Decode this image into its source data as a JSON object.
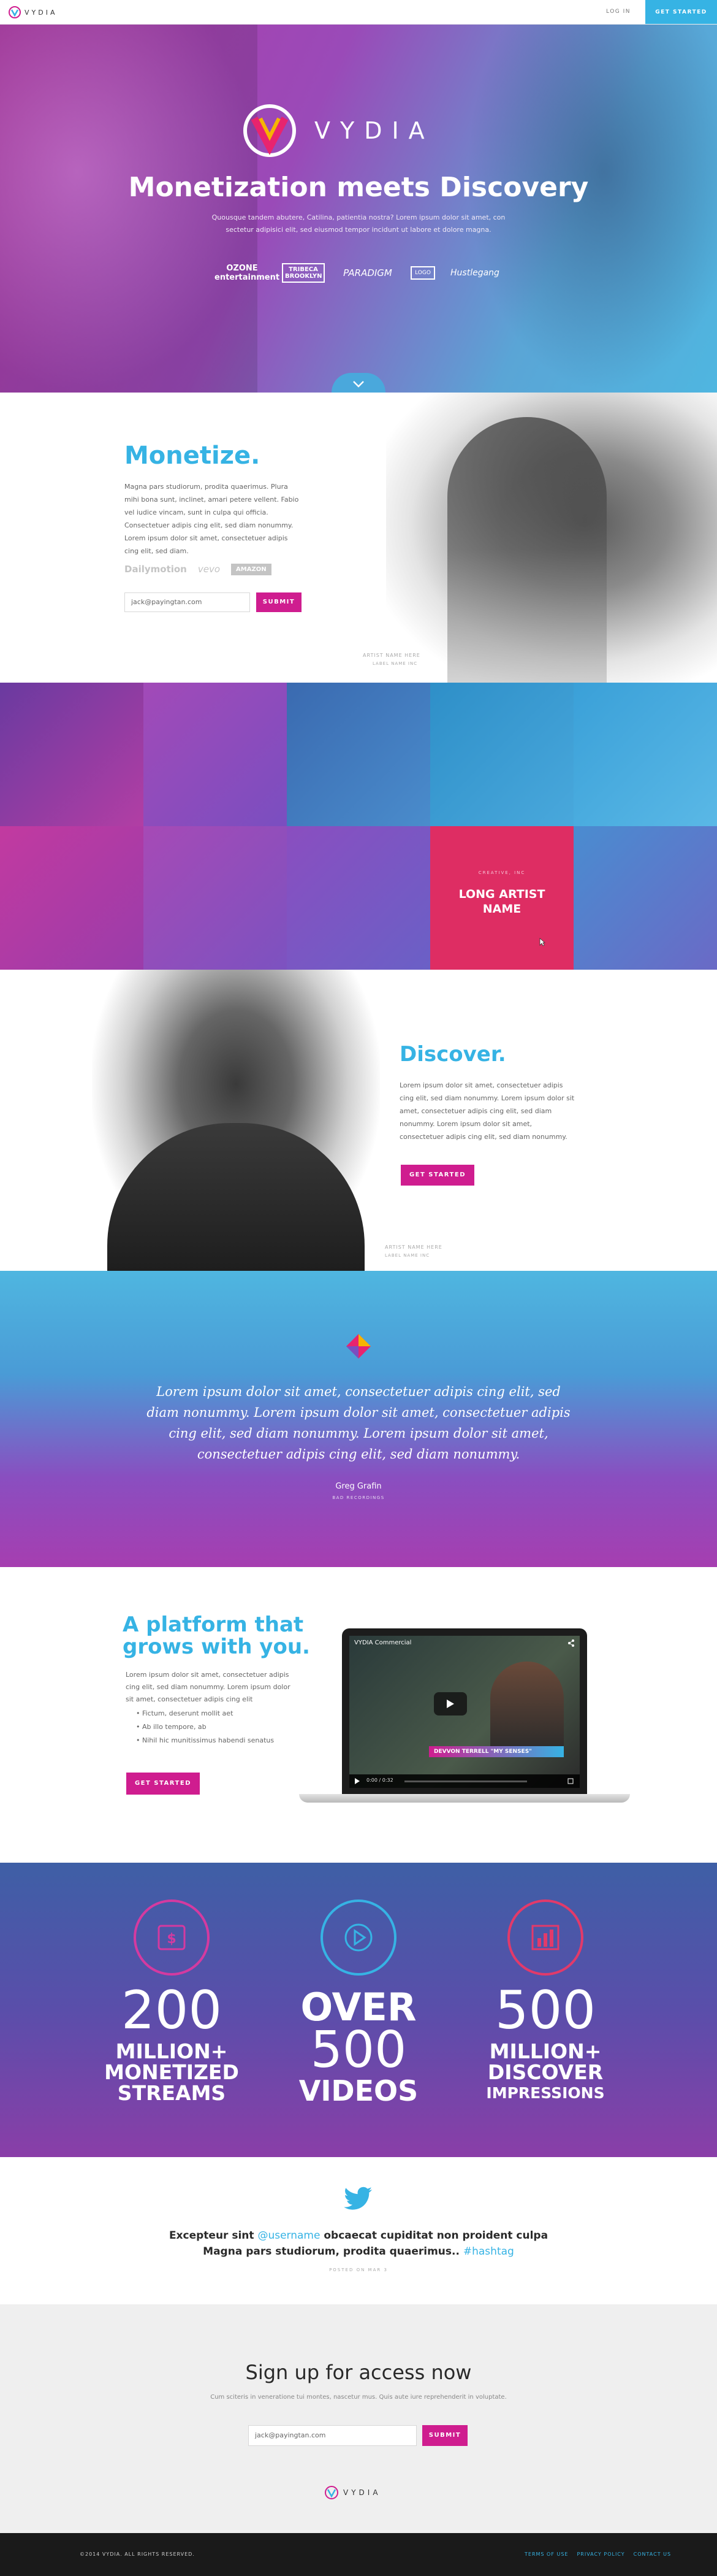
{
  "nav": {
    "brand": "VYDIA",
    "login": "LOG IN",
    "cta": "GET STARTED"
  },
  "hero": {
    "brand": "VYDIA",
    "title": "Monetization meets Discovery",
    "subtitle_line1": "Quousque tandem abutere, Catilina, patientia nostra? Lorem ipsum dolor sit amet, con",
    "subtitle_line2": "sectetur adipisici elit, sed eiusmod tempor incidunt ut labore et dolore magna.",
    "logos": [
      "OZONE entertainment",
      "TRIBECA BROOKLYN",
      "PARADIGM",
      "LOGO",
      "Hustlegang"
    ],
    "scroll_icon": "chevron-down-icon"
  },
  "monetize": {
    "title": "Monetize.",
    "body": "Magna pars studiorum, prodita quaerimus. Plura mihi bona sunt, inclinet, amari petere vellent. Fabio vel iudice vincam, sunt in culpa qui officia. Consectetuer adipis cing elit, sed diam nonummy. Lorem ipsum dolor sit amet, consectetuer adipis cing elit, sed diam.",
    "partners": [
      "Dailymotion",
      "vevo",
      "AMAZON"
    ],
    "email_value": "jack@payingtan.com",
    "submit": "SUBMIT",
    "credit_line1": "ARTIST NAME HERE",
    "credit_line2": "LABEL NAME INC"
  },
  "featured_tile": {
    "kicker": "CREATIVE, INC",
    "name_line1": "LONG ARTIST",
    "name_line2": "NAME"
  },
  "discover": {
    "title": "Discover.",
    "body": "Lorem ipsum dolor sit amet, consectetuer adipis cing elit, sed diam nonummy. Lorem ipsum dolor sit amet, consectetuer adipis cing elit, sed diam nonummy. Lorem ipsum dolor sit amet, consectetuer adipis cing elit, sed diam nonummy.",
    "cta": "GET STARTED",
    "credit_line1": "ARTIST NAME HERE",
    "credit_line2": "LABEL NAME INC"
  },
  "quote": {
    "text": "Lorem ipsum dolor sit amet, consectetuer adipis cing elit, sed diam nonummy. Lorem ipsum dolor sit amet, consectetuer adipis cing elit, sed diam nonummy. Lorem ipsum dolor sit amet, consectetuer adipis cing elit, sed diam nonummy.",
    "author": "Greg Grafin",
    "role": "BAD RECORDINGS"
  },
  "platform": {
    "title_line1": "A platform that",
    "title_line2": "grows with you.",
    "body": "Lorem ipsum dolor sit amet, consectetuer adipis cing elit, sed diam nonummy. Lorem ipsum dolor sit amet, consectetuer adipis cing elit",
    "bullets": [
      "Fictum,  deserunt mollit aet",
      "Ab illo tempore, ab",
      "Nihil hic munitissimus habendi senatus"
    ],
    "cta": "GET STARTED",
    "video_title": "VYDIA Commercial",
    "video_caption": "DEVVON TERRELL \"MY SENSES\"",
    "video_time": "0:00 / 0:32"
  },
  "stats": [
    {
      "icon": "dollar-icon",
      "number": "200",
      "line1": "MILLION+",
      "line2": "MONETIZED",
      "line3": "STREAMS"
    },
    {
      "icon": "play-icon",
      "number_top": "OVER",
      "number": "500",
      "line1": "VIDEOS"
    },
    {
      "icon": "chart-icon",
      "number": "500",
      "line1": "MILLION+",
      "line2": "DISCOVER",
      "line3": "IMPRESSIONS"
    }
  ],
  "tweet": {
    "line1_pre": "Excepteur sint ",
    "mention": "@username",
    "line1_post": " obcaecat cupiditat non proident culpa",
    "line2_pre": "Magna pars studiorum, prodita quaerimus.. ",
    "hashtag": "#hashtag",
    "posted": "POSTED ON MAR 3"
  },
  "signup": {
    "title": "Sign up for access now",
    "subtitle": "Cum sciteris in veneratione tui montes, nascetur mus. Quis aute iure reprehenderit in voluptate.",
    "email_value": "jack@payingtan.com",
    "submit": "SUBMIT"
  },
  "footer": {
    "brand": "VYDIA",
    "copyright": "©2014 VYDIA. ALL RIGHTS RESERVED.",
    "links": [
      "TERMS OF USE",
      "PRIVACY POLICY",
      "CONTACT US"
    ]
  },
  "colors": {
    "accent_cyan": "#36b3e4",
    "accent_pink": "#cf1d8f",
    "magenta": "#b43aa8",
    "dark": "#1a1a1a"
  }
}
